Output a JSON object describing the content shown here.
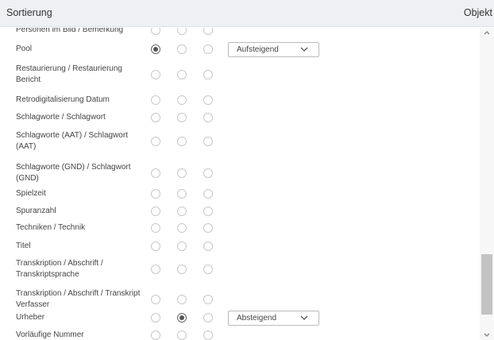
{
  "header": {
    "title": "Sortierung",
    "right_label": "Objekt"
  },
  "rows": [
    {
      "label": "Personen im Bild / Bemerkung",
      "selected": 0,
      "select": null
    },
    {
      "label": "Pool",
      "selected": 1,
      "select": "Aufsteigend"
    },
    {
      "label": "Restaurierung / Restaurierung Bericht",
      "selected": 0,
      "select": null
    },
    {
      "label": "Retrodigitalisierung Datum",
      "selected": 0,
      "select": null
    },
    {
      "label": "Schlagworte / Schlagwort",
      "selected": 0,
      "select": null
    },
    {
      "label": "Schlagworte (AAT) / Schlagwort (AAT)",
      "selected": 0,
      "select": null
    },
    {
      "label": "Schlagworte (GND) / Schlagwort (GND)",
      "selected": 0,
      "select": null
    },
    {
      "label": "Spielzeit",
      "selected": 0,
      "select": null
    },
    {
      "label": "Spuranzahl",
      "selected": 0,
      "select": null
    },
    {
      "label": "Techniken / Technik",
      "selected": 0,
      "select": null
    },
    {
      "label": "Titel",
      "selected": 0,
      "select": null
    },
    {
      "label": "Transkription / Abschrift / Transkriptsprache",
      "selected": 0,
      "select": null
    },
    {
      "label": "Transkription / Abschrift / Transkript Verfasser",
      "selected": 0,
      "select": null
    },
    {
      "label": "Urheber",
      "selected": 2,
      "select": "Absteigend"
    },
    {
      "label": "Vorläufige Nummer",
      "selected": 0,
      "select": null
    }
  ],
  "colors": {
    "header_bg": "#eef0f3",
    "scroll_thumb": "#c3c3c3"
  },
  "icons": {
    "select": "chevron-down-icon",
    "scroll_up": "caret-up-icon",
    "scroll_down": "caret-down-icon"
  }
}
